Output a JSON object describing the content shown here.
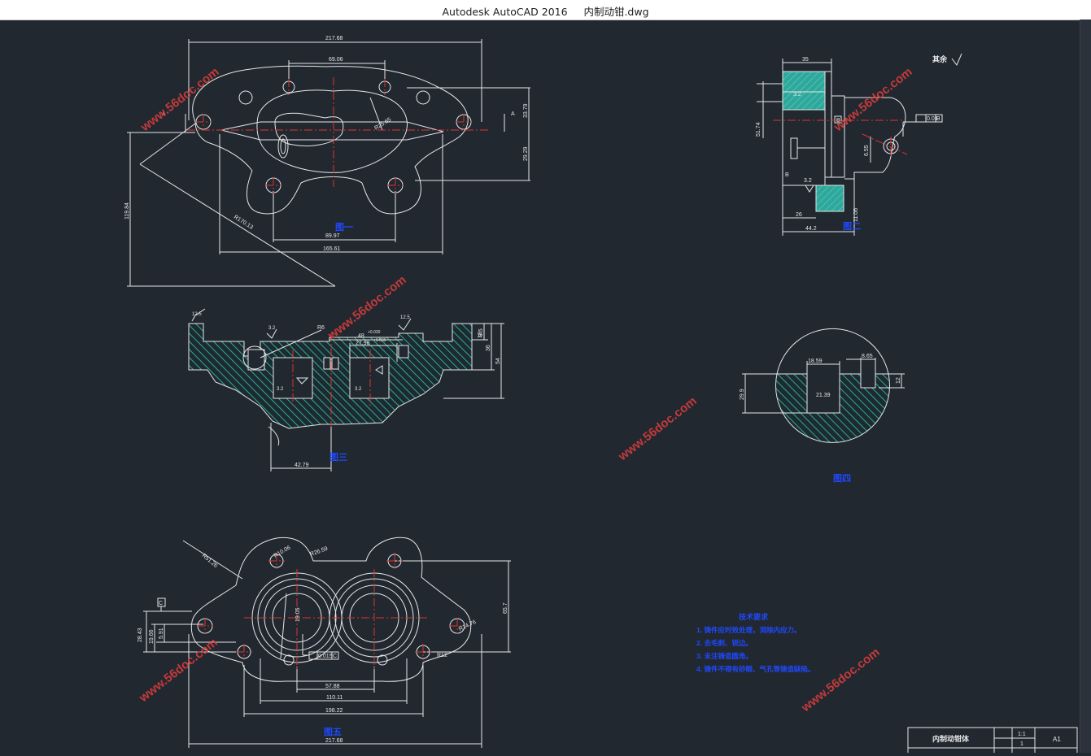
{
  "window": {
    "app_name": "Autodesk AutoCAD 2016",
    "file_name": "内制动钳.dwg"
  },
  "colors": {
    "background": "#212830",
    "lines": "#e6e6e6",
    "hatch": "#2fa89c",
    "center": "#e0332a",
    "annotation": "#1f49ff",
    "watermark": "#d63c3c"
  },
  "watermark_text": "www.56doc.com",
  "top_view": {
    "dims": [
      "217.68",
      "69.06",
      "33.79",
      "29.29",
      "89.97",
      "165.61",
      "119.84",
      "R170.13",
      "R25.65"
    ],
    "section_mark": "A",
    "label": "图一"
  },
  "side_view": {
    "dims": [
      "35",
      "51.74",
      "6.55",
      "26",
      "44.2",
      "11.06",
      "3.2"
    ],
    "datum": "B",
    "tolerance": "0.01",
    "roughness_note": "其余",
    "label": "图二"
  },
  "section_view": {
    "dims": [
      "48",
      "27.98",
      "9.5",
      "18",
      "36",
      "54",
      "42.79",
      "R6",
      "3.2",
      "12.5"
    ],
    "tol_upper": "+0.030",
    "tol_upper2": "+0.030",
    "label": "图三"
  },
  "circle_view": {
    "dims": [
      "18.59",
      "8.65",
      "12",
      "29.9",
      "21.39"
    ],
    "label": "图四"
  },
  "bottom_view": {
    "dims": [
      "R51.26",
      "R10.06",
      "R26.59",
      "28.43",
      "19.66",
      "5.91",
      "65.7",
      "57.88",
      "110.11",
      "198.22",
      "217.68",
      "R12",
      "R14.76",
      "19.05"
    ],
    "datum": "C",
    "tolerance": "0.015",
    "label": "图五"
  },
  "tech_notes": {
    "title": "技术要求",
    "items": [
      "1. 铸件应时效处理，消除内应力。",
      "2. 去毛刺、锐边。",
      "3. 未注铸造圆角。",
      "4. 铸件不得有砂眼、气孔等铸造缺陷。"
    ]
  },
  "title_block": {
    "part_name": "内制动钳体",
    "scale": "1:1",
    "quantity": "1",
    "sheet": "A1"
  }
}
